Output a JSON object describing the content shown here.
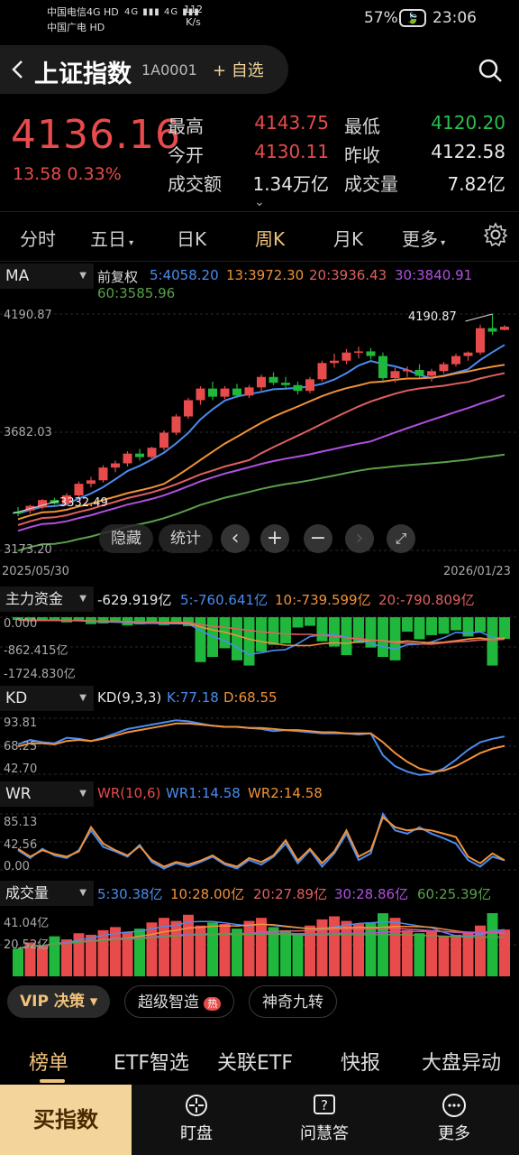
{
  "status": {
    "carrier1": "中国电信4G HD",
    "carrier2": "中国广电 HD",
    "signal": "4G ▮▮▮ 4G ▮▮▮",
    "speed_value": "112",
    "speed_unit": "K/s",
    "battery": "57%",
    "time": "23:06"
  },
  "header": {
    "back_icon": "chevron-left-icon",
    "title": "上证指数",
    "code": "1A0001",
    "add_watch": "+ 自选",
    "search_icon": "search-icon"
  },
  "quote": {
    "price": "4136.16",
    "change": "13.58  0.33%",
    "rows": [
      {
        "l1": "最高",
        "v1": "4143.75",
        "c1": "red",
        "l2": "最低",
        "v2": "4120.20",
        "c2": "grn"
      },
      {
        "l1": "今开",
        "v1": "4130.11",
        "c1": "red",
        "l2": "昨收",
        "v2": "4122.58",
        "c2": "wht"
      },
      {
        "l1": "成交额",
        "v1": "1.34万亿",
        "c1": "wht",
        "l2": "成交量",
        "v2": "7.82亿",
        "c2": "wht"
      }
    ]
  },
  "tabs": [
    {
      "label": "分时",
      "active": false
    },
    {
      "label": "五日",
      "active": false
    },
    {
      "label": "日K",
      "active": false
    },
    {
      "label": "周K",
      "active": true
    },
    {
      "label": "月K",
      "active": false
    },
    {
      "label": "更多",
      "active": false
    }
  ],
  "ma": {
    "button": "MA",
    "adjust": "前复权",
    "values": [
      {
        "text": "5:4058.20",
        "color": "#4a8cf0"
      },
      {
        "text": "13:3972.30",
        "color": "#f0923a"
      },
      {
        "text": "20:3936.43",
        "color": "#e06060"
      },
      {
        "text": "30:3840.91",
        "color": "#b050e0"
      },
      {
        "text": "60:3585.96",
        "color": "#5aa04a"
      }
    ],
    "y_top": "4190.87",
    "y_mid": "3682.03",
    "y_bot": "3173.20",
    "high_label": "4190.87",
    "low_label": "3332.49",
    "date_start": "2025/05/30",
    "date_end": "2026/01/23",
    "hide": "隐藏",
    "stats": "统计"
  },
  "fund": {
    "button": "主力资金",
    "main": "-629.919亿",
    "v5": "5:-760.641亿",
    "v10": "10:-739.599亿",
    "v20": "20:-790.809亿",
    "y_top": "0.000",
    "y_mid": "-862.415亿",
    "y_bot": "-1724.830亿"
  },
  "kd": {
    "button": "KD",
    "param": "KD(9,3,3)",
    "k": "K:77.18",
    "d": "D:68.55",
    "y_top": "93.81",
    "y_mid": "68.25",
    "y_bot": "42.70"
  },
  "wr": {
    "button": "WR",
    "param": "WR(10,6)",
    "wr1": "WR1:14.58",
    "wr2": "WR2:14.58",
    "y_top": "85.13",
    "y_mid": "42.56",
    "y_bot": "0.00"
  },
  "vol": {
    "button": "成交量",
    "v5": "5:30.38亿",
    "v10": "10:28.00亿",
    "v20": "20:27.89亿",
    "v30": "30:28.86亿",
    "v60": "60:25.39亿",
    "y_top": "41.04亿",
    "y_mid": "20.52亿"
  },
  "tools": {
    "vip": "VIP 决策 ▾",
    "chip1": "超级智造",
    "hot_badge": "热",
    "chip2": "神奇九转"
  },
  "bottom_tabs": [
    {
      "label": "榜单",
      "active": true
    },
    {
      "label": "ETF智选",
      "active": false
    },
    {
      "label": "关联ETF",
      "active": false
    },
    {
      "label": "快报",
      "active": false
    },
    {
      "label": "大盘异动",
      "active": false
    }
  ],
  "nav": {
    "buy": "买指数",
    "watch": "盯盘",
    "ask": "问慧答",
    "more": "更多"
  },
  "chart_data": [
    {
      "type": "candlestick",
      "period": "weekly",
      "x_range": [
        "2025/05/30",
        "2026/01/23"
      ],
      "ylim": [
        3173.2,
        4190.87
      ],
      "ohlc": [
        [
          3340,
          3360,
          3320,
          3332.49
        ],
        [
          3345,
          3370,
          3332,
          3365
        ],
        [
          3360,
          3395,
          3350,
          3390
        ],
        [
          3390,
          3400,
          3370,
          3375
        ],
        [
          3375,
          3420,
          3365,
          3410
        ],
        [
          3410,
          3470,
          3400,
          3460
        ],
        [
          3460,
          3490,
          3445,
          3475
        ],
        [
          3475,
          3540,
          3465,
          3530
        ],
        [
          3530,
          3560,
          3510,
          3548
        ],
        [
          3548,
          3600,
          3535,
          3590
        ],
        [
          3590,
          3610,
          3560,
          3575
        ],
        [
          3575,
          3620,
          3560,
          3615
        ],
        [
          3615,
          3690,
          3605,
          3680
        ],
        [
          3680,
          3760,
          3670,
          3750
        ],
        [
          3750,
          3830,
          3740,
          3820
        ],
        [
          3820,
          3880,
          3800,
          3870
        ],
        [
          3870,
          3900,
          3820,
          3835
        ],
        [
          3835,
          3880,
          3825,
          3870
        ],
        [
          3870,
          3890,
          3830,
          3840
        ],
        [
          3840,
          3885,
          3830,
          3875
        ],
        [
          3875,
          3930,
          3860,
          3920
        ],
        [
          3920,
          3940,
          3885,
          3895
        ],
        [
          3895,
          3920,
          3865,
          3885
        ],
        [
          3885,
          3900,
          3845,
          3860
        ],
        [
          3860,
          3920,
          3850,
          3910
        ],
        [
          3910,
          3990,
          3900,
          3980
        ],
        [
          3980,
          4020,
          3960,
          3990
        ],
        [
          3990,
          4040,
          3975,
          4025
        ],
        [
          4025,
          4050,
          4000,
          4030
        ],
        [
          4030,
          4045,
          3995,
          4010
        ],
        [
          4010,
          4025,
          3905,
          3915
        ],
        [
          3915,
          3960,
          3895,
          3945
        ],
        [
          3945,
          3965,
          3920,
          3950
        ],
        [
          3950,
          3975,
          3915,
          3925
        ],
        [
          3925,
          3955,
          3900,
          3945
        ],
        [
          3945,
          3985,
          3935,
          3975
        ],
        [
          3975,
          4020,
          3965,
          4010
        ],
        [
          4010,
          4030,
          3990,
          4025
        ],
        [
          4025,
          4145,
          4015,
          4130
        ],
        [
          4130,
          4190.87,
          4100,
          4115
        ],
        [
          4122.58,
          4143.75,
          4120.2,
          4136.16
        ]
      ],
      "ma_series": [
        {
          "name": "MA5",
          "last": 4058.2
        },
        {
          "name": "MA13",
          "last": 3972.3
        },
        {
          "name": "MA20",
          "last": 3936.43
        },
        {
          "name": "MA30",
          "last": 3840.91
        },
        {
          "name": "MA60",
          "last": 3585.96
        }
      ],
      "high_mark": 4190.87,
      "low_mark": 3332.49
    },
    {
      "type": "bar",
      "title": "主力资金",
      "ylim": [
        -1724.83,
        0
      ],
      "values": [
        -80,
        -120,
        -100,
        -90,
        -150,
        -110,
        -200,
        -180,
        -160,
        -240,
        -210,
        -190,
        -230,
        -170,
        -260,
        -1300,
        -1150,
        -900,
        -1250,
        -1400,
        -1000,
        -800,
        -760,
        -300,
        -250,
        -700,
        -850,
        -1100,
        -750,
        -880,
        -1150,
        -1250,
        -420,
        -640,
        -520,
        -480,
        -380,
        -560,
        -430,
        -1400,
        -629.919
      ],
      "averages": [
        {
          "name": "5",
          "last": -760.641
        },
        {
          "name": "10",
          "last": -739.599
        },
        {
          "name": "20",
          "last": -790.809
        }
      ]
    },
    {
      "type": "line",
      "title": "KD(9,3,3)",
      "ylim": [
        42.7,
        93.81
      ],
      "series": [
        {
          "name": "K",
          "values": [
            70,
            74,
            72,
            71,
            76,
            75,
            73,
            76,
            80,
            84,
            86,
            88,
            90,
            92,
            91,
            89,
            87,
            86,
            86,
            85,
            84,
            82,
            83,
            82,
            81,
            80,
            80,
            80,
            79,
            80,
            60,
            50,
            45,
            42,
            43,
            48,
            56,
            65,
            72,
            75,
            77.18
          ]
        },
        {
          "name": "D",
          "values": [
            68,
            71,
            71,
            70,
            73,
            74,
            73,
            75,
            78,
            81,
            83,
            85,
            87,
            89,
            89,
            88,
            87,
            86,
            86,
            85,
            85,
            84,
            83,
            83,
            82,
            81,
            81,
            80,
            80,
            80,
            72,
            62,
            54,
            48,
            45,
            46,
            50,
            56,
            62,
            66,
            68.55
          ]
        }
      ]
    },
    {
      "type": "line",
      "title": "WR(10,6)",
      "ylim": [
        0,
        85.13
      ],
      "series": [
        {
          "name": "WR1",
          "values": [
            30,
            18,
            32,
            22,
            18,
            30,
            60,
            35,
            28,
            20,
            38,
            12,
            2,
            10,
            5,
            12,
            20,
            8,
            2,
            15,
            8,
            20,
            40,
            10,
            30,
            5,
            25,
            55,
            15,
            25,
            85,
            60,
            55,
            65,
            55,
            48,
            40,
            15,
            5,
            20,
            14.58
          ]
        },
        {
          "name": "WR2",
          "values": [
            32,
            20,
            30,
            24,
            20,
            28,
            65,
            40,
            30,
            22,
            36,
            15,
            5,
            12,
            8,
            14,
            22,
            10,
            5,
            18,
            12,
            22,
            45,
            14,
            32,
            10,
            28,
            60,
            20,
            30,
            80,
            65,
            60,
            62,
            60,
            55,
            50,
            20,
            10,
            25,
            14.58
          ]
        }
      ]
    },
    {
      "type": "bar",
      "title": "成交量",
      "ylim": [
        0,
        41.04
      ],
      "values": [
        18,
        22,
        20,
        26,
        24,
        28,
        27,
        30,
        32,
        29,
        31,
        35,
        38,
        36,
        40,
        33,
        35,
        34,
        31,
        36,
        38,
        32,
        30,
        28,
        33,
        37,
        39,
        36,
        34,
        35,
        41,
        38,
        30,
        28,
        30,
        26,
        27,
        29,
        33,
        43,
        30.38
      ],
      "averages": [
        {
          "name": "5",
          "last": 30.38
        },
        {
          "name": "10",
          "last": 28.0
        },
        {
          "name": "20",
          "last": 27.89
        },
        {
          "name": "30",
          "last": 28.86
        },
        {
          "name": "60",
          "last": 25.39
        }
      ]
    }
  ]
}
